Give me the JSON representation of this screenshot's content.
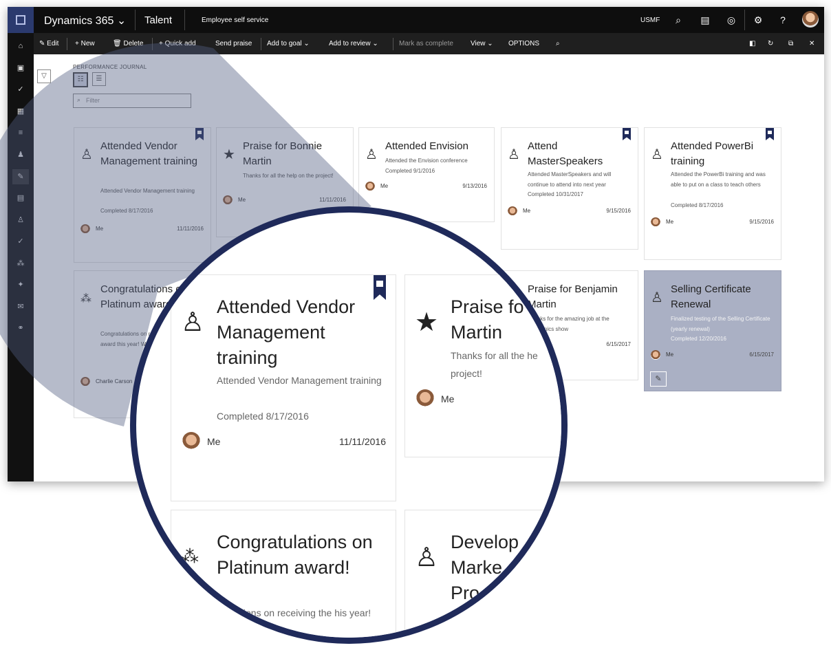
{
  "topnav": {
    "brand": "Dynamics 365",
    "brand_chevron": "⌄",
    "module": "Talent",
    "section": "Employee self service",
    "company": "USMF"
  },
  "actionbar": {
    "edit": "Edit",
    "new": "+ New",
    "delete": "Delete",
    "quick_add": "+ Quick add",
    "send_praise": "Send praise",
    "add_to_goal": "Add to goal",
    "add_to_review": "Add to review",
    "mark_complete": "Mark as complete",
    "view": "View",
    "options": "OPTIONS"
  },
  "journal": {
    "label": "PERFORMANCE JOURNAL",
    "filter_placeholder": "Filter"
  },
  "cards": [
    {
      "title": "Attended Vendor Management training",
      "desc": "Attended Vendor Management training",
      "completed": "Completed 8/17/2016",
      "who": "Me",
      "date": "11/11/2016",
      "icon": "person-icon"
    },
    {
      "title": "Praise for Bonnie Martin",
      "desc": "Thanks for all the help on the project!",
      "completed": "",
      "who": "Me",
      "date": "11/11/2016",
      "icon": "star-icon"
    },
    {
      "title": "Attended Envision",
      "desc": "Attended the Envision conference",
      "completed": "Completed 9/1/2016",
      "who": "Me",
      "date": "9/13/2016",
      "icon": "person-icon"
    },
    {
      "title": "Attend MasterSpeakers",
      "desc": "Attended MasterSpeakers and will continue to attend into next year",
      "completed": "Completed 10/31/2017",
      "who": "Me",
      "date": "9/15/2016",
      "icon": "person-icon"
    },
    {
      "title": "Attended PowerBi training",
      "desc": "Attended the PowerBi training and was able to put on a class to teach others",
      "completed": "Completed 8/17/2016",
      "who": "Me",
      "date": "9/15/2016",
      "icon": "person-icon"
    },
    {
      "title": "Congratulations on Platinum award!",
      "desc": "Congratulations on receiving the Platinum award this year! Well done.",
      "completed": "",
      "who": "Charlie Carson",
      "date": "",
      "icon": "group-icon"
    },
    {
      "title": "Praise for Benjamin Martin",
      "desc": "Thanks for the amazing job at the electronics show",
      "completed": "",
      "who": "",
      "date": "6/15/2017",
      "icon": "star-icon"
    },
    {
      "title": "Selling Certificate Renewal",
      "desc": "Finalized testing of the Selling Certificate (yearly renewal)",
      "completed": "Completed 12/20/2016",
      "who": "Me",
      "date": "6/15/2017",
      "icon": "person-icon"
    }
  ],
  "zoom": {
    "card1": {
      "title": "Attended Vendor Management training",
      "desc": "Attended Vendor Management training",
      "completed": "Completed 8/17/2016",
      "who": "Me",
      "date": "11/11/2016"
    },
    "card2": {
      "title": "Praise for Bonnie Martin",
      "title_visible": "Praise fo\nMartin",
      "desc": "Thanks for all the he project!",
      "who": "Me"
    },
    "card3": {
      "title": "Congratulations on Platinum award!",
      "desc": "ratulations on receiving the his year! Well"
    },
    "card4": {
      "title": "Develop Marke Pro"
    }
  }
}
